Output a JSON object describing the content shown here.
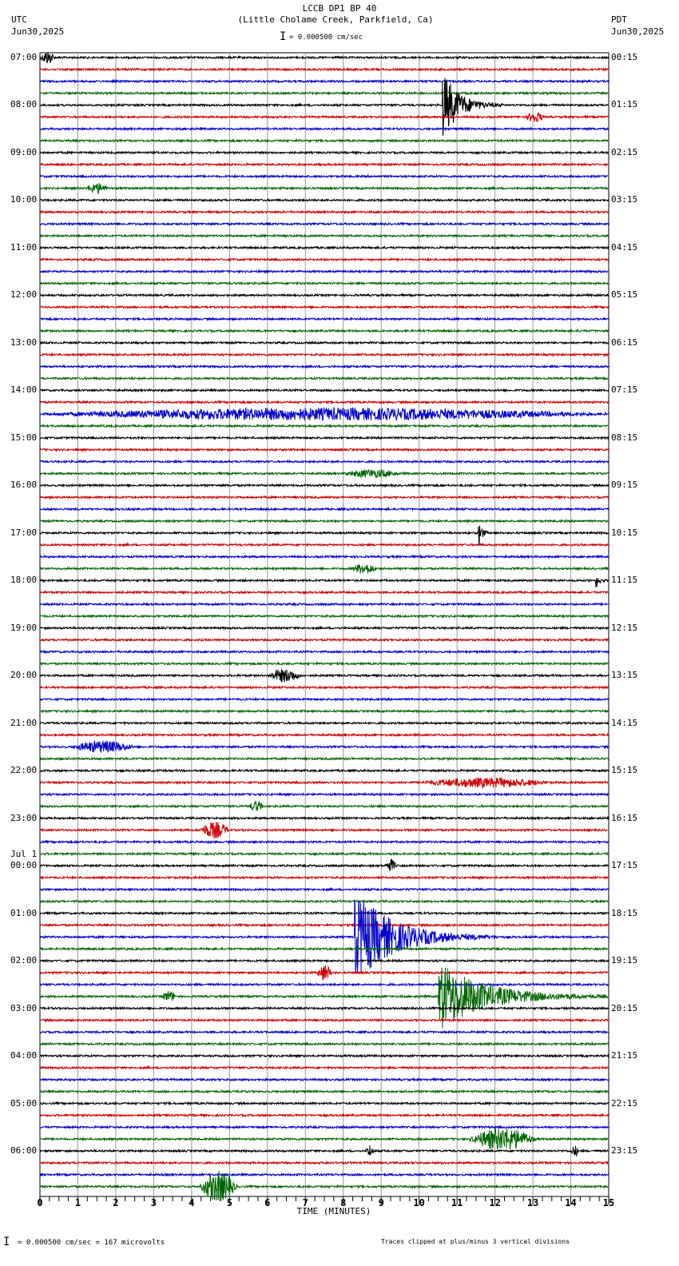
{
  "header": {
    "title": "LCCB DP1 BP 40",
    "subtitle": "(Little Cholame Creek, Parkfield, Ca)",
    "left_tz": "UTC",
    "left_date": "Jun30,2025",
    "right_tz": "PDT",
    "right_date": "Jun30,2025",
    "scale": "= 0.000500 cm/sec"
  },
  "footer": {
    "scale": "= 0.000500 cm/sec =      167 microvolts",
    "clip_note": "Traces clipped at plus/minus 3 vertical divisions"
  },
  "chart_data": {
    "type": "line",
    "xlabel": "TIME (MINUTES)",
    "xlim": [
      0,
      15
    ],
    "xticks": [
      "0",
      "1",
      "2",
      "3",
      "4",
      "5",
      "6",
      "7",
      "8",
      "9",
      "10",
      "11",
      "12",
      "13",
      "14",
      "15"
    ],
    "left_labels": [
      "07:00",
      "08:00",
      "09:00",
      "10:00",
      "11:00",
      "12:00",
      "13:00",
      "14:00",
      "15:00",
      "16:00",
      "17:00",
      "18:00",
      "19:00",
      "20:00",
      "21:00",
      "22:00",
      "23:00",
      "00:00",
      "01:00",
      "02:00",
      "03:00",
      "04:00",
      "05:00",
      "06:00"
    ],
    "day_change_label": "Jul 1",
    "right_labels": [
      "00:15",
      "01:15",
      "02:15",
      "03:15",
      "04:15",
      "05:15",
      "06:15",
      "07:15",
      "08:15",
      "09:15",
      "10:15",
      "11:15",
      "12:15",
      "13:15",
      "14:15",
      "15:15",
      "16:15",
      "17:15",
      "18:15",
      "19:15",
      "20:15",
      "21:15",
      "22:15",
      "23:15"
    ],
    "trace_colors": [
      "#000000",
      "#cc0000",
      "#0000cc",
      "#006600"
    ],
    "traces_per_hour": 4,
    "clip_divisions": 3,
    "events": [
      {
        "trace": 0,
        "start": 0,
        "dur": 0.4,
        "amp": 1.0
      },
      {
        "trace": 4,
        "start": 10.6,
        "dur": 1.6,
        "amp": 6,
        "spike": true
      },
      {
        "trace": 5,
        "start": 12.8,
        "dur": 0.5,
        "amp": 0.8
      },
      {
        "trace": 11,
        "start": 1.2,
        "dur": 0.6,
        "amp": 0.8
      },
      {
        "trace": 30,
        "start": 0,
        "dur": 15,
        "amp": 0.9
      },
      {
        "trace": 35,
        "start": 8.0,
        "dur": 1.5,
        "amp": 0.6
      },
      {
        "trace": 40,
        "start": 11.55,
        "dur": 0.3,
        "amp": 3,
        "spike": true
      },
      {
        "trace": 43,
        "start": 8.2,
        "dur": 0.7,
        "amp": 0.8
      },
      {
        "trace": 44,
        "start": 14.65,
        "dur": 0.3,
        "amp": 1.5,
        "spike": true
      },
      {
        "trace": 52,
        "start": 6.0,
        "dur": 0.9,
        "amp": 1.0
      },
      {
        "trace": 58,
        "start": 0.8,
        "dur": 1.7,
        "amp": 0.9
      },
      {
        "trace": 61,
        "start": 10.0,
        "dur": 3.5,
        "amp": 0.7
      },
      {
        "trace": 63,
        "start": 5.5,
        "dur": 0.4,
        "amp": 0.8
      },
      {
        "trace": 65,
        "start": 4.2,
        "dur": 0.8,
        "amp": 1.3
      },
      {
        "trace": 68,
        "start": 9.1,
        "dur": 0.3,
        "amp": 1.0
      },
      {
        "trace": 74,
        "start": 8.3,
        "dur": 3.8,
        "amp": 8,
        "spike": true
      },
      {
        "trace": 77,
        "start": 7.3,
        "dur": 0.4,
        "amp": 1.3
      },
      {
        "trace": 79,
        "start": 3.2,
        "dur": 0.4,
        "amp": 0.8
      },
      {
        "trace": 79,
        "start": 10.5,
        "dur": 4.5,
        "amp": 6,
        "spike": true
      },
      {
        "trace": 91,
        "start": 11.3,
        "dur": 1.8,
        "amp": 1.8
      },
      {
        "trace": 92,
        "start": 8.6,
        "dur": 0.2,
        "amp": 1.0
      },
      {
        "trace": 92,
        "start": 14.0,
        "dur": 0.2,
        "amp": 0.8
      },
      {
        "trace": 95,
        "start": 4.2,
        "dur": 1.0,
        "amp": 2.5
      }
    ]
  }
}
